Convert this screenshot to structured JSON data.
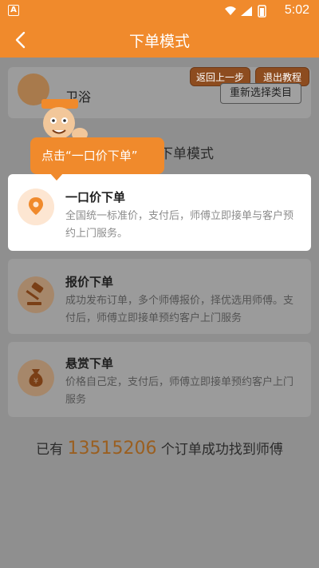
{
  "status_bar": {
    "app_badge": "A",
    "time": "5:02"
  },
  "app_bar": {
    "title": "下单模式"
  },
  "category": {
    "label": "卫浴",
    "reselect_label": "重新选择类目",
    "back_step_label": "返回上一步",
    "exit_tutorial_label": "退出教程"
  },
  "section": {
    "title": "下单模式"
  },
  "tooltip": {
    "text": "点击“一口价下单”"
  },
  "modes": [
    {
      "name": "一口价下单",
      "description": "全国统一标准价，支付后，师傅立即接单与客户预约上门服务。"
    },
    {
      "name": "报价下单",
      "description": "成功发布订单，多个师傅报价，择优选用师傅。支付后，师傅立即接单预约客户上门服务"
    },
    {
      "name": "悬赏下单",
      "description": "价格自己定，支付后，师傅立即接单预约客户上门服务"
    }
  ],
  "footer": {
    "prefix": "已有",
    "count": "13515206",
    "suffix": "个订单成功找到师傅"
  },
  "colors": {
    "brand_orange": "#f08a2c",
    "overlay": "#8f8f8f"
  }
}
